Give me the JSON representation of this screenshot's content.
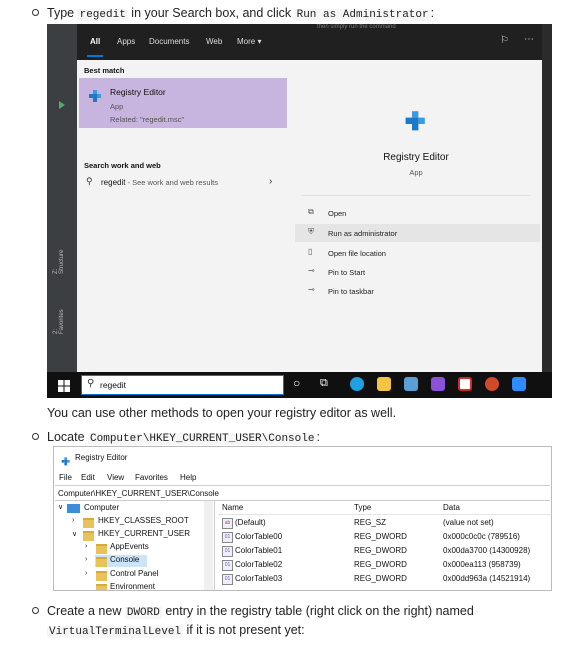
{
  "step1": {
    "prefix": "Type",
    "code1": "regedit",
    "mid": "in your Search box, and click",
    "code2": "Run as Administrator",
    "suffix": ":"
  },
  "windows_search": {
    "tabs": [
      "All",
      "Apps",
      "Documents",
      "Web",
      "More"
    ],
    "background_snippet": "then simply run the command",
    "best_match_label": "Best match",
    "app_name": "Registry Editor",
    "app_type": "App",
    "related": "Related: \"regedit.msc\"",
    "search_work_web": "Search work and web",
    "web_query": "regedit",
    "web_query_suffix": " - See work and web results",
    "detail_title": "Registry Editor",
    "detail_type": "App",
    "actions": [
      "Open",
      "Run as administrator",
      "Open file location",
      "Pin to Start",
      "Pin to taskbar"
    ],
    "search_value": "regedit",
    "ide_labels": [
      "Z: Structure",
      "2: Favorites"
    ]
  },
  "note": "You can use other methods to open your registry editor as well.",
  "step2": {
    "prefix": "Locate",
    "code": "Computer\\HKEY_CURRENT_USER\\Console",
    "suffix": ":"
  },
  "registry": {
    "title": "Registry Editor",
    "menu": [
      "File",
      "Edit",
      "View",
      "Favorites",
      "Help"
    ],
    "address": "Computer\\HKEY_CURRENT_USER\\Console",
    "tree": [
      "Computer",
      "HKEY_CLASSES_ROOT",
      "HKEY_CURRENT_USER",
      "AppEvents",
      "Console",
      "Control Panel",
      "Environment"
    ],
    "columns": [
      "Name",
      "Type",
      "Data"
    ],
    "rows": [
      {
        "name": "(Default)",
        "type": "REG_SZ",
        "data": "(value not set)"
      },
      {
        "name": "ColorTable00",
        "type": "REG_DWORD",
        "data": "0x000c0c0c (789516)"
      },
      {
        "name": "ColorTable01",
        "type": "REG_DWORD",
        "data": "0x00da3700 (14300928)"
      },
      {
        "name": "ColorTable02",
        "type": "REG_DWORD",
        "data": "0x000ea113 (958739)"
      },
      {
        "name": "ColorTable03",
        "type": "REG_DWORD",
        "data": "0x00dd963a (14521914)"
      }
    ]
  },
  "step3": {
    "prefix": "Create a new",
    "code": "DWORD",
    "mid": "entry in the registry table (right click on the right) named",
    "code2": "VirtualTerminalLevel",
    "suffix": "if it is not present yet:"
  }
}
